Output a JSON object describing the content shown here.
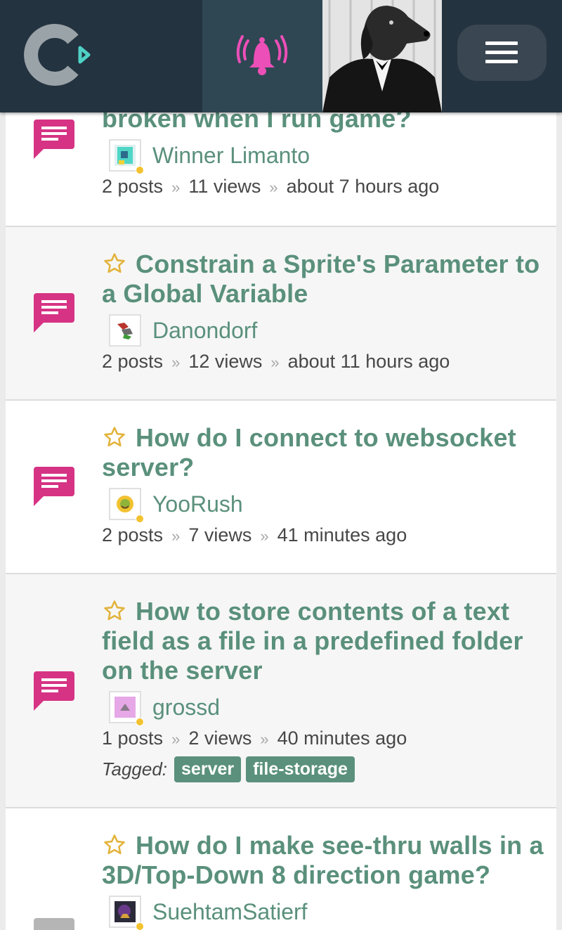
{
  "colors": {
    "accent": "#5a907c",
    "topbar": "#243340",
    "chat_icon": "#d63384",
    "star": "#e2b33c"
  },
  "header": {
    "logo_icon": "construct-logo-icon",
    "notification_icon": "bell-ringing-icon",
    "menu_icon": "hamburger-menu-icon"
  },
  "topics": [
    {
      "title": "broken when I run game?",
      "author": "Winner Limanto",
      "posts": "2 posts",
      "views": "11 views",
      "time": "about 7 hours ago",
      "separator": "»"
    },
    {
      "title": "Constrain a Sprite's Parameter to a Global Variable",
      "author": "Danondorf",
      "posts": "2 posts",
      "views": "12 views",
      "time": "about 11 hours ago",
      "separator": "»"
    },
    {
      "title": "How do I connect to websocket server?",
      "author": "YooRush",
      "posts": "2 posts",
      "views": "7 views",
      "time": "41 minutes ago",
      "separator": "»"
    },
    {
      "title": "How to store contents of a text field as a file in a predefined folder on the server",
      "author": "grossd",
      "posts": "1 posts",
      "views": "2 views",
      "time": "40 minutes ago",
      "separator": "»",
      "tagged_label": "Tagged:",
      "tags": [
        "server",
        "file-storage"
      ]
    },
    {
      "title": "How do I make see-thru walls in a 3D/Top-Down 8 direction game?",
      "author": "SuehtamSatierf"
    }
  ]
}
